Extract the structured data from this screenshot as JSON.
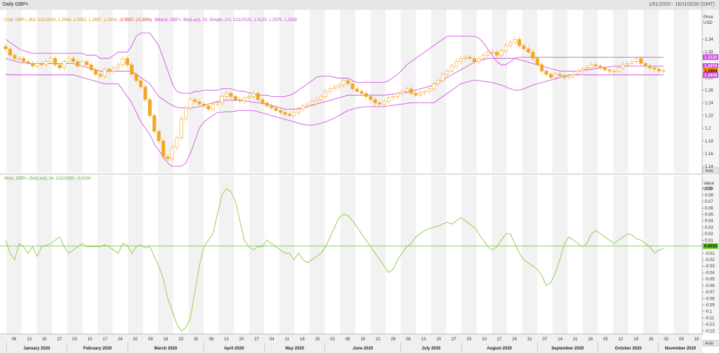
{
  "window": {
    "title": "Daily GBP=",
    "date_range": "1/01/2020 - 18/11/2020 (GMT)"
  },
  "price_panel": {
    "legend_ohlc": "Cndl, GBP=, Bid, 2/11/2020, 1.2944, 1.2952, 1.2897, 1.2904, ",
    "legend_change": "-0.0037, (-0.29%)",
    "legend_bband": "BBand, GBP=, Bid(Last), 20, Simple, 2.0, 2/11/2020, 1.3120, 1.2979, 1.2838",
    "axis_title": "Price",
    "axis_unit": "USD",
    "auto_label": "Auto",
    "y_ticks": [
      "1.14",
      "1.16",
      "1.18",
      "1.2",
      "1.22",
      "1.24",
      "1.26",
      "1.28",
      "1.3",
      "1.32",
      "1.34"
    ],
    "last_price_label": "1.2904",
    "bband_upper_label": "1.3120",
    "bband_mid_label": "1.2979",
    "bband_lower_label": "1.2838",
    "colors": {
      "candle": "#f5a623",
      "band": "#cc44dd",
      "last_price_bg": "#ff9900",
      "band_label_bg": "#cc44dd"
    }
  },
  "mom_panel": {
    "legend": "Mom, GBP=, Bid(Last), 14, 2/11/2020, -0.0030",
    "axis_title": "Value",
    "axis_unit": "USD",
    "auto_label": "Auto",
    "y_ticks": [
      "0.09",
      "0.08",
      "0.07",
      "0.06",
      "0.05",
      "0.04",
      "0.03",
      "0.02",
      "0.01",
      "0",
      "-0.01",
      "-0.02",
      "-0.03",
      "-0.04",
      "-0.05",
      "-0.06",
      "-0.07",
      "-0.08",
      "-0.09",
      "-0.1",
      "-0.11",
      "-0.12",
      "-0.13"
    ],
    "zero_label": "0.0010",
    "colors": {
      "line": "#88cc44",
      "zero_line": "#66cc22"
    }
  },
  "time_axis": {
    "days": [
      "06",
      "13",
      "20",
      "27",
      "03",
      "10",
      "17",
      "24",
      "02",
      "09",
      "16",
      "23",
      "30",
      "06",
      "13",
      "20",
      "27",
      "04",
      "11",
      "18",
      "25",
      "01",
      "08",
      "15",
      "22",
      "29",
      "06",
      "13",
      "20",
      "27",
      "03",
      "10",
      "17",
      "24",
      "31",
      "07",
      "14",
      "21",
      "28",
      "05",
      "12",
      "19",
      "26",
      "02",
      "09",
      "16"
    ],
    "months": [
      "January 2020",
      "February 2020",
      "March 2020",
      "April 2020",
      "May 2020",
      "June 2020",
      "July 2020",
      "August 2020",
      "September 2020",
      "October 2020",
      "November 2020"
    ]
  },
  "chart_data": [
    {
      "type": "candlestick",
      "series_name": "GBP=",
      "x_start": "2020-01-06",
      "x_end": "2020-11-02",
      "ylim": [
        1.13,
        1.36
      ],
      "close": [
        1.325,
        1.315,
        1.31,
        1.31,
        1.305,
        1.302,
        1.298,
        1.302,
        1.3,
        1.305,
        1.31,
        1.3,
        1.295,
        1.305,
        1.31,
        1.305,
        1.298,
        1.305,
        1.3,
        1.292,
        1.285,
        1.282,
        1.293,
        1.29,
        1.295,
        1.3,
        1.31,
        1.3,
        1.285,
        1.275,
        1.265,
        1.245,
        1.22,
        1.195,
        1.18,
        1.155,
        1.152,
        1.17,
        1.185,
        1.215,
        1.232,
        1.245,
        1.242,
        1.238,
        1.235,
        1.23,
        1.238,
        1.24,
        1.25,
        1.255,
        1.25,
        1.245,
        1.243,
        1.248,
        1.25,
        1.255,
        1.245,
        1.24,
        1.235,
        1.232,
        1.228,
        1.225,
        1.222,
        1.22,
        1.225,
        1.23,
        1.235,
        1.238,
        1.242,
        1.245,
        1.25,
        1.258,
        1.262,
        1.265,
        1.268,
        1.275,
        1.27,
        1.262,
        1.258,
        1.255,
        1.25,
        1.245,
        1.24,
        1.238,
        1.242,
        1.248,
        1.25,
        1.255,
        1.258,
        1.262,
        1.255,
        1.252,
        1.256,
        1.258,
        1.262,
        1.27,
        1.275,
        1.285,
        1.29,
        1.298,
        1.305,
        1.31,
        1.312,
        1.31,
        1.305,
        1.31,
        1.315,
        1.32,
        1.32,
        1.315,
        1.322,
        1.33,
        1.335,
        1.34,
        1.33,
        1.325,
        1.32,
        1.31,
        1.3,
        1.29,
        1.285,
        1.28,
        1.285,
        1.283,
        1.28,
        1.282,
        1.285,
        1.29,
        1.293,
        1.295,
        1.3,
        1.298,
        1.295,
        1.292,
        1.29,
        1.29,
        1.295,
        1.3,
        1.302,
        1.305,
        1.31,
        1.302,
        1.298,
        1.295,
        1.293,
        1.29,
        1.2904
      ],
      "bband_upper": [
        1.34,
        1.335,
        1.33,
        1.325,
        1.322,
        1.32,
        1.318,
        1.318,
        1.318,
        1.318,
        1.318,
        1.318,
        1.318,
        1.318,
        1.318,
        1.318,
        1.318,
        1.318,
        1.315,
        1.315,
        1.315,
        1.31,
        1.31,
        1.31,
        1.315,
        1.32,
        1.32,
        1.32,
        1.33,
        1.345,
        1.35,
        1.35,
        1.35,
        1.34,
        1.33,
        1.31,
        1.29,
        1.27,
        1.258,
        1.255,
        1.255,
        1.255,
        1.258,
        1.258,
        1.26,
        1.26,
        1.26,
        1.26,
        1.262,
        1.262,
        1.262,
        1.26,
        1.258,
        1.258,
        1.256,
        1.254,
        1.252,
        1.252,
        1.252,
        1.25,
        1.25,
        1.25,
        1.25,
        1.252,
        1.255,
        1.26,
        1.265,
        1.27,
        1.275,
        1.28,
        1.282,
        1.282,
        1.282,
        1.28,
        1.279,
        1.279,
        1.279,
        1.275,
        1.272,
        1.272,
        1.272,
        1.272,
        1.272,
        1.272,
        1.272,
        1.275,
        1.28,
        1.285,
        1.292,
        1.3,
        1.305,
        1.31,
        1.315,
        1.32,
        1.325,
        1.33,
        1.335,
        1.34,
        1.345,
        1.345,
        1.345,
        1.345,
        1.345,
        1.345,
        1.345,
        1.342,
        1.335,
        1.325,
        1.315,
        1.305,
        1.3,
        1.3,
        1.305,
        1.31,
        1.312,
        1.312,
        1.312,
        1.312,
        1.312,
        1.312,
        1.312,
        1.312,
        1.312,
        1.312,
        1.312,
        1.312,
        1.312,
        1.312,
        1.312,
        1.312,
        1.312,
        1.312,
        1.312,
        1.312,
        1.312,
        1.312,
        1.312,
        1.312,
        1.312,
        1.312,
        1.312,
        1.312,
        1.312,
        1.312,
        1.312,
        1.312,
        1.312
      ],
      "bband_mid": [
        1.31,
        1.308,
        1.306,
        1.304,
        1.303,
        1.302,
        1.302,
        1.302,
        1.302,
        1.302,
        1.302,
        1.302,
        1.302,
        1.302,
        1.302,
        1.302,
        1.3,
        1.298,
        1.296,
        1.294,
        1.292,
        1.29,
        1.29,
        1.29,
        1.29,
        1.29,
        1.29,
        1.29,
        1.29,
        1.285,
        1.28,
        1.275,
        1.27,
        1.26,
        1.25,
        1.245,
        1.24,
        1.236,
        1.233,
        1.232,
        1.232,
        1.232,
        1.233,
        1.234,
        1.236,
        1.238,
        1.24,
        1.242,
        1.243,
        1.244,
        1.244,
        1.244,
        1.244,
        1.243,
        1.242,
        1.241,
        1.24,
        1.239,
        1.238,
        1.236,
        1.234,
        1.232,
        1.23,
        1.23,
        1.23,
        1.231,
        1.232,
        1.234,
        1.236,
        1.238,
        1.24,
        1.242,
        1.244,
        1.246,
        1.248,
        1.25,
        1.252,
        1.252,
        1.252,
        1.252,
        1.252,
        1.252,
        1.252,
        1.252,
        1.252,
        1.253,
        1.254,
        1.255,
        1.256,
        1.257,
        1.258,
        1.26,
        1.262,
        1.264,
        1.266,
        1.268,
        1.272,
        1.276,
        1.28,
        1.284,
        1.288,
        1.292,
        1.296,
        1.3,
        1.304,
        1.306,
        1.308,
        1.31,
        1.31,
        1.31,
        1.31,
        1.31,
        1.31,
        1.31,
        1.308,
        1.306,
        1.304,
        1.302,
        1.3,
        1.298,
        1.296,
        1.294,
        1.292,
        1.29,
        1.29,
        1.29,
        1.29,
        1.29,
        1.291,
        1.292,
        1.293,
        1.294,
        1.295,
        1.296,
        1.297,
        1.298,
        1.298,
        1.298,
        1.298,
        1.298,
        1.298,
        1.298,
        1.298,
        1.298,
        1.298,
        1.298,
        1.2979
      ],
      "bband_lower": [
        1.285,
        1.284,
        1.284,
        1.284,
        1.284,
        1.284,
        1.284,
        1.284,
        1.284,
        1.284,
        1.284,
        1.284,
        1.284,
        1.284,
        1.284,
        1.284,
        1.282,
        1.28,
        1.278,
        1.276,
        1.274,
        1.272,
        1.27,
        1.27,
        1.27,
        1.27,
        1.26,
        1.25,
        1.24,
        1.225,
        1.21,
        1.2,
        1.19,
        1.175,
        1.165,
        1.155,
        1.145,
        1.14,
        1.14,
        1.14,
        1.145,
        1.16,
        1.18,
        1.2,
        1.21,
        1.215,
        1.22,
        1.225,
        1.225,
        1.226,
        1.226,
        1.227,
        1.228,
        1.228,
        1.228,
        1.228,
        1.226,
        1.224,
        1.222,
        1.22,
        1.218,
        1.216,
        1.214,
        1.212,
        1.21,
        1.208,
        1.206,
        1.205,
        1.205,
        1.206,
        1.208,
        1.21,
        1.213,
        1.216,
        1.22,
        1.224,
        1.228,
        1.23,
        1.232,
        1.233,
        1.234,
        1.234,
        1.234,
        1.234,
        1.234,
        1.235,
        1.236,
        1.237,
        1.238,
        1.239,
        1.24,
        1.24,
        1.24,
        1.24,
        1.24,
        1.24,
        1.245,
        1.25,
        1.255,
        1.26,
        1.265,
        1.27,
        1.272,
        1.274,
        1.276,
        1.275,
        1.274,
        1.273,
        1.272,
        1.27,
        1.268,
        1.265,
        1.262,
        1.26,
        1.26,
        1.262,
        1.265,
        1.268,
        1.27,
        1.272,
        1.274,
        1.276,
        1.278,
        1.28,
        1.282,
        1.284,
        1.284,
        1.284,
        1.284,
        1.284,
        1.284,
        1.284,
        1.284,
        1.284,
        1.284,
        1.284,
        1.284,
        1.284,
        1.284,
        1.284,
        1.284,
        1.284,
        1.284,
        1.284,
        1.284,
        1.284,
        1.2838
      ]
    },
    {
      "type": "line",
      "series_name": "Mom",
      "ylim": [
        -0.135,
        0.095
      ],
      "values": [
        0.01,
        -0.01,
        -0.02,
        0.005,
        0.0,
        -0.01,
        0.0,
        -0.015,
        0.0,
        0.002,
        0.005,
        0.01,
        0.015,
        0.0,
        -0.01,
        -0.005,
        0.0,
        0.005,
        0.0,
        0.0,
        0.0,
        0.0,
        0.003,
        0.0,
        -0.005,
        -0.01,
        0.005,
        0.002,
        -0.01,
        0.0,
        0.003,
        -0.002,
        0.0,
        -0.015,
        -0.03,
        -0.05,
        -0.08,
        -0.1,
        -0.12,
        -0.13,
        -0.125,
        -0.11,
        -0.07,
        -0.03,
        0.0,
        0.01,
        0.02,
        0.05,
        0.08,
        0.09,
        0.085,
        0.07,
        0.04,
        0.01,
        0.0,
        -0.005,
        0.0,
        0.0,
        0.01,
        0.005,
        0.0,
        -0.005,
        -0.01,
        -0.01,
        -0.02,
        -0.01,
        -0.02,
        -0.025,
        -0.02,
        -0.015,
        -0.01,
        0.0,
        0.015,
        0.03,
        0.045,
        0.05,
        0.048,
        0.04,
        0.03,
        0.02,
        0.01,
        0.0,
        -0.01,
        -0.02,
        -0.03,
        -0.04,
        -0.035,
        -0.02,
        -0.01,
        0.0,
        0.005,
        0.015,
        0.02,
        0.025,
        0.028,
        0.03,
        0.032,
        0.035,
        0.038,
        0.035,
        0.04,
        0.045,
        0.04,
        0.035,
        0.03,
        0.02,
        0.01,
        0.0,
        -0.005,
        0.0,
        0.01,
        0.02,
        0.02,
        0.005,
        -0.01,
        -0.02,
        -0.025,
        -0.03,
        -0.035,
        -0.045,
        -0.06,
        -0.055,
        -0.04,
        -0.02,
        0.005,
        0.015,
        0.01,
        0.005,
        0.0,
        0.005,
        0.02,
        0.025,
        0.02,
        0.015,
        0.01,
        0.005,
        0.01,
        0.015,
        0.02,
        0.018,
        0.012,
        0.01,
        0.005,
        0.0,
        -0.01,
        -0.005,
        -0.003
      ]
    }
  ]
}
